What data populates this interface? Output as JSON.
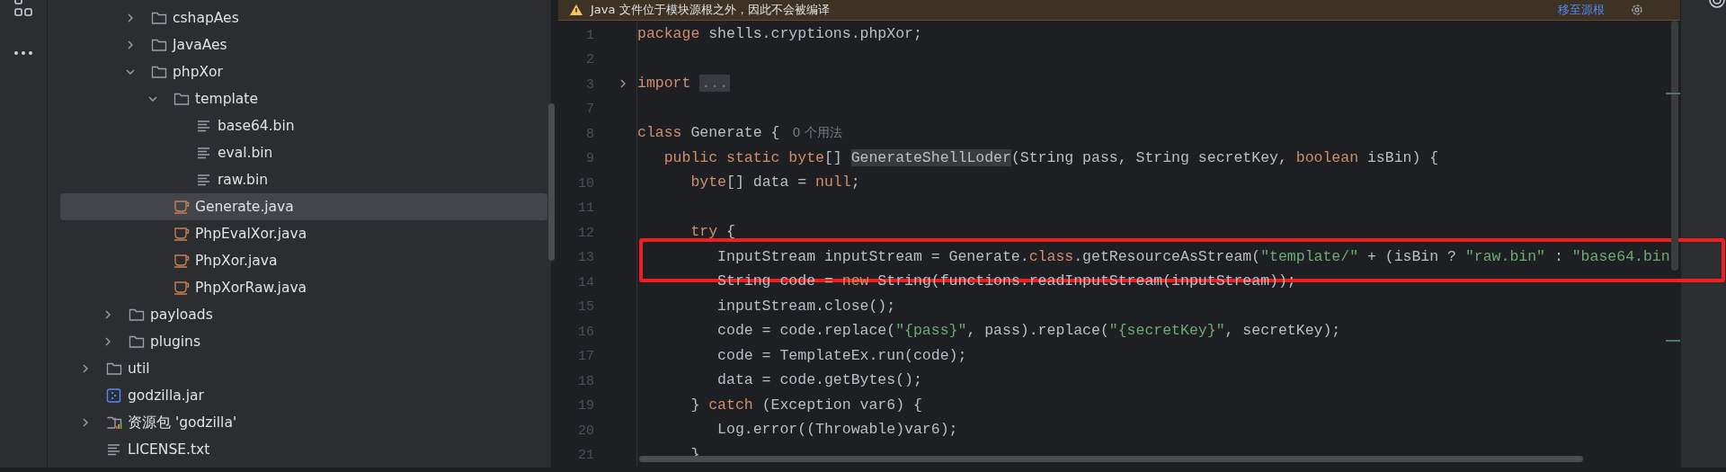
{
  "tree": {
    "items": [
      {
        "children": [
          {
            "children": [
              {
                "label": "cshapAes",
                "kind": "folder",
                "expanded": false,
                "selected": false
              },
              {
                "label": "JavaAes",
                "kind": "folder",
                "expanded": false,
                "selected": false
              },
              {
                "label": "phpXor",
                "kind": "folder",
                "expanded": true,
                "selected": false,
                "children": [
                  {
                    "label": "template",
                    "kind": "folder",
                    "expanded": true,
                    "selected": false,
                    "children": [
                      {
                        "label": "base64.bin",
                        "kind": "text",
                        "selected": false
                      },
                      {
                        "label": "eval.bin",
                        "kind": "text",
                        "selected": false
                      },
                      {
                        "label": "raw.bin",
                        "kind": "text",
                        "selected": false
                      }
                    ]
                  },
                  {
                    "label": "Generate.java",
                    "kind": "java",
                    "selected": true
                  },
                  {
                    "label": "PhpEvalXor.java",
                    "kind": "java",
                    "selected": false
                  },
                  {
                    "label": "PhpXor.java",
                    "kind": "java",
                    "selected": false
                  },
                  {
                    "label": "PhpXorRaw.java",
                    "kind": "java",
                    "selected": false
                  }
                ]
              }
            ]
          },
          {
            "label": "payloads",
            "kind": "folder",
            "expanded": false,
            "selected": false
          },
          {
            "label": "plugins",
            "kind": "folder",
            "expanded": false,
            "selected": false
          }
        ]
      },
      {
        "label": "util",
        "kind": "folder",
        "expanded": false,
        "selected": false
      },
      {
        "label": "godzilla.jar",
        "kind": "jar",
        "selected": false
      },
      {
        "label": "资源包 'godzilla'",
        "kind": "library",
        "expanded": false,
        "selected": false
      },
      {
        "label": "LICENSE.txt",
        "kind": "text",
        "selected": false
      }
    ]
  },
  "banner": {
    "message": "Java 文件位于模块源根之外，因此不会被编译",
    "link": "移至源根"
  },
  "editor": {
    "lines": [
      {
        "number": "1",
        "fold": false,
        "boxed": false,
        "tokens": [
          {
            "kind": "keyword",
            "text": "package"
          },
          {
            "kind": "plain",
            "text": " shells.cryptions.phpXor;"
          }
        ]
      },
      {
        "number": "2",
        "fold": false,
        "boxed": false
      },
      {
        "number": "3",
        "fold": true,
        "boxed": false,
        "tokens": [
          {
            "kind": "keyword",
            "text": "import"
          },
          {
            "kind": "folded",
            "text": "..."
          }
        ]
      },
      {
        "number": "7",
        "fold": false,
        "boxed": false
      },
      {
        "number": "8",
        "fold": false,
        "boxed": false,
        "tokens": [
          {
            "kind": "keyword",
            "text": "class"
          },
          {
            "kind": "plain",
            "text": " Generate {"
          },
          {
            "kind": "hint",
            "text": "0 个用法"
          }
        ]
      },
      {
        "number": "9",
        "fold": false,
        "boxed": false,
        "tokens": [
          {
            "kind": "keyword",
            "text": "   public static byte"
          },
          {
            "kind": "plain",
            "text": "[] "
          },
          {
            "kind": "usage",
            "text": "GenerateShellLoder"
          },
          {
            "kind": "plain",
            "text": "(String pass, String secretKey, "
          },
          {
            "kind": "keyword",
            "text": "boolean"
          },
          {
            "kind": "plain",
            "text": " isBin) {"
          }
        ]
      },
      {
        "number": "10",
        "fold": false,
        "boxed": false,
        "tokens": [
          {
            "kind": "keyword",
            "text": "      byte"
          },
          {
            "kind": "plain",
            "text": "[] data = "
          },
          {
            "kind": "keyword",
            "text": "null"
          },
          {
            "kind": "plain",
            "text": ";"
          }
        ]
      },
      {
        "number": "11",
        "fold": false,
        "boxed": false
      },
      {
        "number": "12",
        "fold": false,
        "boxed": false,
        "tokens": [
          {
            "kind": "keyword",
            "text": "      try"
          },
          {
            "kind": "plain",
            "text": " {"
          }
        ]
      },
      {
        "number": "13",
        "fold": false,
        "boxed": true,
        "tokens": [
          {
            "kind": "plain",
            "text": "         InputStream inputStream = Generate."
          },
          {
            "kind": "keyword",
            "text": "class"
          },
          {
            "kind": "plain",
            "text": ".getResourceAsStream("
          },
          {
            "kind": "string",
            "text": "\"template/\""
          },
          {
            "kind": "plain",
            "text": " + (isBin ? "
          },
          {
            "kind": "string",
            "text": "\"raw.bin\""
          },
          {
            "kind": "plain",
            "text": " : "
          },
          {
            "kind": "string",
            "text": "\"base64.bin"
          }
        ]
      },
      {
        "number": "14",
        "fold": false,
        "boxed": false,
        "tokens": [
          {
            "kind": "plain",
            "text": "         String code = "
          },
          {
            "kind": "keyword",
            "text": "new"
          },
          {
            "kind": "plain",
            "text": " String(functions.readInputStream(inputStream));"
          }
        ]
      },
      {
        "number": "15",
        "fold": false,
        "boxed": false,
        "tokens": [
          {
            "kind": "plain",
            "text": "         inputStream.close();"
          }
        ]
      },
      {
        "number": "16",
        "fold": false,
        "boxed": false,
        "tokens": [
          {
            "kind": "plain",
            "text": "         code = code.replace("
          },
          {
            "kind": "string",
            "text": "\"{pass}\""
          },
          {
            "kind": "plain",
            "text": ", pass).replace("
          },
          {
            "kind": "string",
            "text": "\"{secretKey}\""
          },
          {
            "kind": "plain",
            "text": ", secretKey);"
          }
        ]
      },
      {
        "number": "17",
        "fold": false,
        "boxed": false,
        "tokens": [
          {
            "kind": "plain",
            "text": "         code = TemplateEx.run(code);"
          }
        ]
      },
      {
        "number": "18",
        "fold": false,
        "boxed": false,
        "tokens": [
          {
            "kind": "plain",
            "text": "         data = code.getBytes();"
          }
        ]
      },
      {
        "number": "19",
        "fold": false,
        "boxed": false,
        "tokens": [
          {
            "kind": "plain",
            "text": "      } "
          },
          {
            "kind": "keyword",
            "text": "catch"
          },
          {
            "kind": "plain",
            "text": " (Exception var6) {"
          }
        ]
      },
      {
        "number": "20",
        "fold": false,
        "boxed": false,
        "tokens": [
          {
            "kind": "plain",
            "text": "         Log.error((Throwable)var6);"
          }
        ]
      },
      {
        "number": "21",
        "fold": false,
        "boxed": false,
        "tokens": [
          {
            "kind": "plain",
            "text": "      }"
          }
        ]
      }
    ]
  }
}
